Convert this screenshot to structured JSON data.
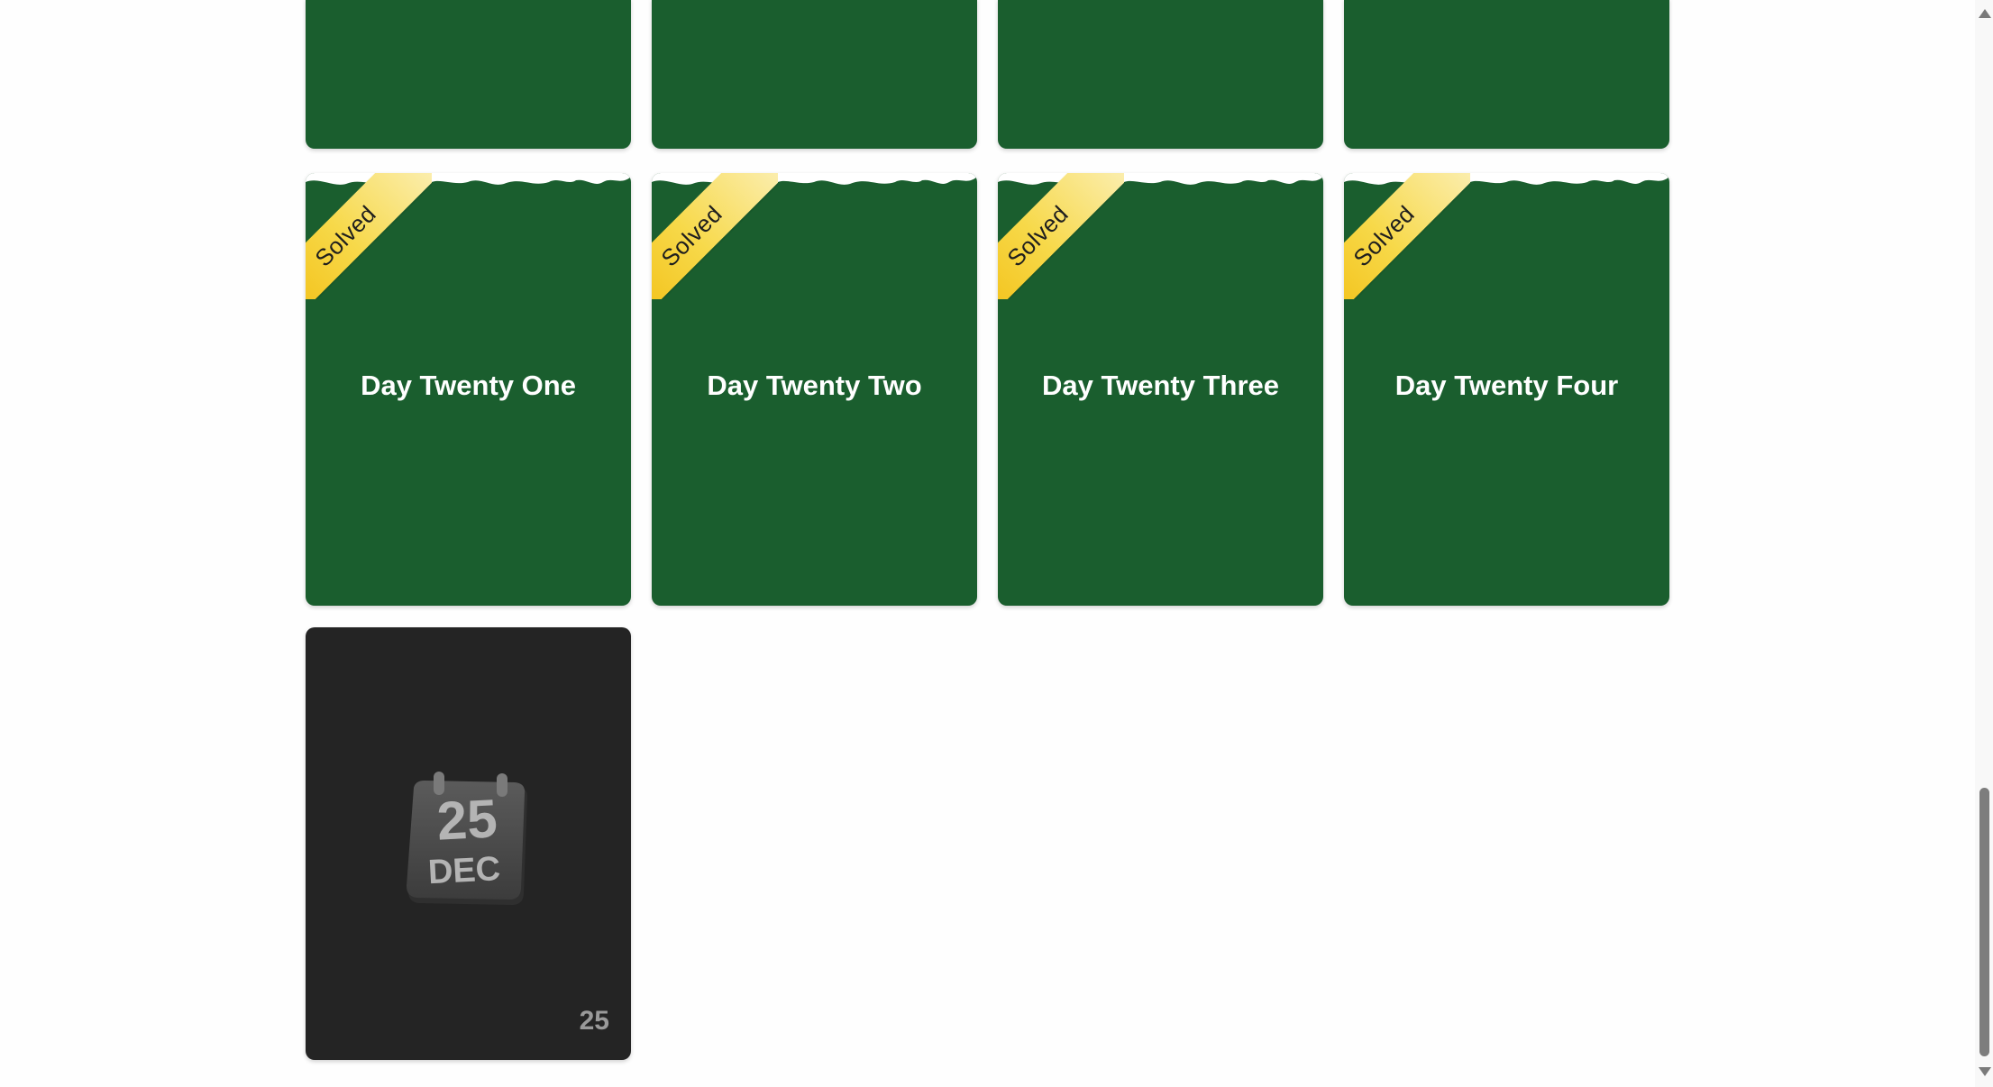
{
  "colors": {
    "card_green": "#1a5e2e",
    "card_locked": "#242424",
    "ribbon_gold": "#f5c82a",
    "title_text": "#ffffff"
  },
  "top_row_cards": [
    {
      "label": ""
    },
    {
      "label": ""
    },
    {
      "label": ""
    },
    {
      "label": ""
    }
  ],
  "solved_cards": [
    {
      "title": "Day Twenty One",
      "badge": "Solved"
    },
    {
      "title": "Day Twenty Two",
      "badge": "Solved"
    },
    {
      "title": "Day Twenty Three",
      "badge": "Solved"
    },
    {
      "title": "Day Twenty Four",
      "badge": "Solved"
    }
  ],
  "locked_card": {
    "icon": "calendar-icon",
    "icon_day": "25",
    "icon_month": "DEC",
    "day_number": "25"
  }
}
